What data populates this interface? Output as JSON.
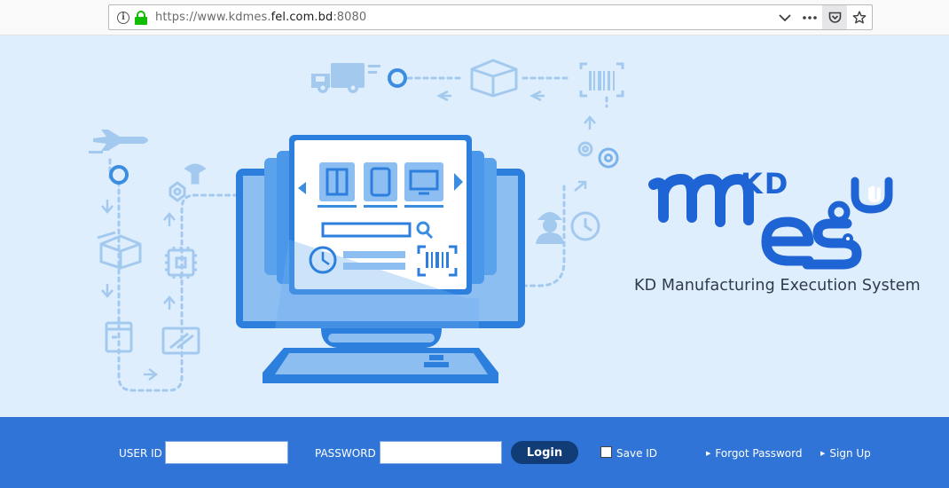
{
  "browser": {
    "url_prefix": "https://www.kdmes.",
    "url_domain": "fel.com.bd",
    "url_suffix": ":8080",
    "info_glyph": "i",
    "icons": [
      "info-icon",
      "lock-icon",
      "chevron-down-icon",
      "more-icon",
      "pocket-icon",
      "bookmark-star-icon"
    ]
  },
  "brand": {
    "logo_kd": "KD",
    "logo_u": "U",
    "subtitle": "KD Manufacturing Execution System"
  },
  "login": {
    "user_id_label": "USER ID",
    "user_id_value": "",
    "password_label": "PASSWORD",
    "password_value": "",
    "login_button": "Login",
    "save_id_label": "Save ID",
    "save_id_checked": false,
    "forgot_password": "Forgot Password",
    "sign_up": "Sign Up",
    "link_arrow": "▶"
  },
  "colors": {
    "hero_bg": "#dfeefc",
    "bar_bg": "#2f74d6",
    "login_button": "#113c75",
    "logo_blue": "#1f64d4"
  }
}
